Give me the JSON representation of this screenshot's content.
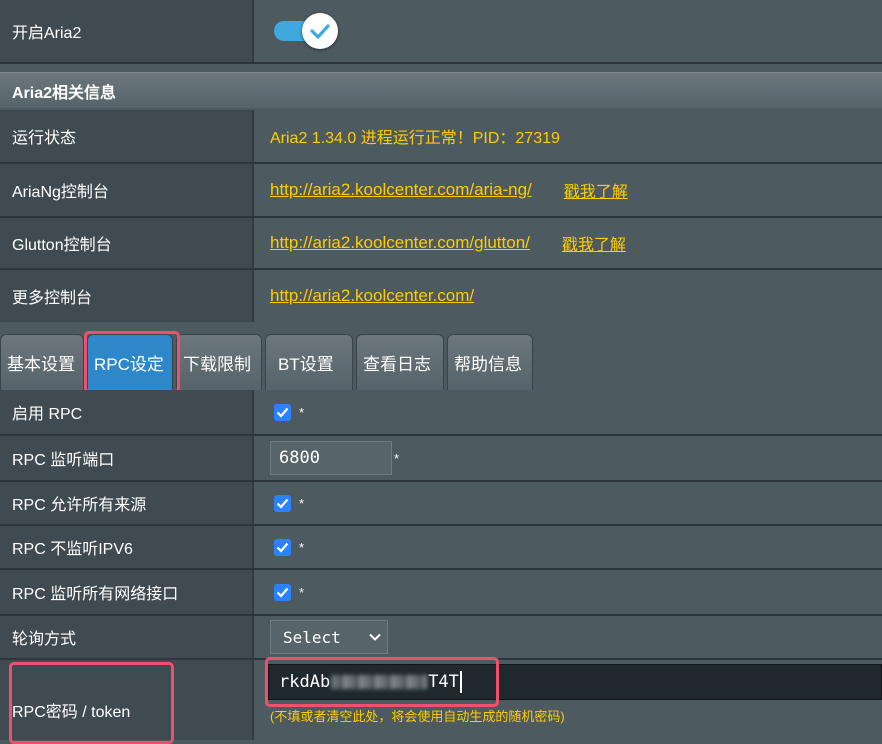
{
  "enable_row": {
    "label": "开启Aria2",
    "enabled": true
  },
  "section_title": "Aria2相关信息",
  "info": {
    "status_label": "运行状态",
    "status_value": "Aria2 1.34.0 进程运行正常！PID：27319",
    "ariang_label": "AriaNg控制台",
    "ariang_url": "http://aria2.koolcenter.com/aria-ng/",
    "ariang_more": "戳我了解",
    "glutton_label": "Glutton控制台",
    "glutton_url": "http://aria2.koolcenter.com/glutton/",
    "glutton_more": "戳我了解",
    "more_label": "更多控制台",
    "more_url": "http://aria2.koolcenter.com/"
  },
  "tabs": [
    {
      "label": "基本设置",
      "active": false
    },
    {
      "label": "RPC设定",
      "active": true
    },
    {
      "label": "下载限制",
      "active": false
    },
    {
      "label": "BT设置",
      "active": false
    },
    {
      "label": "查看日志",
      "active": false
    },
    {
      "label": "帮助信息",
      "active": false
    }
  ],
  "rpc": {
    "enable_label": "启用 RPC",
    "port_label": "RPC 监听端口",
    "port_value": "6800",
    "allow_all_label": "RPC 允许所有来源",
    "no_ipv6_label": "RPC 不监听IPV6",
    "listen_all_label": "RPC 监听所有网络接口",
    "poll_label": "轮询方式",
    "poll_value": "Select",
    "token_label": "RPC密码 / token",
    "token_prefix": "rkdAb",
    "token_suffix": "T4T",
    "token_hint": "(不填或者清空此处，将会使用自动生成的随机密码)",
    "required_mark": "*"
  },
  "colors": {
    "accent": "#2e87c8",
    "link": "#ffcc00",
    "highlight": "#f0506e",
    "checkbox": "#2b82ff"
  }
}
